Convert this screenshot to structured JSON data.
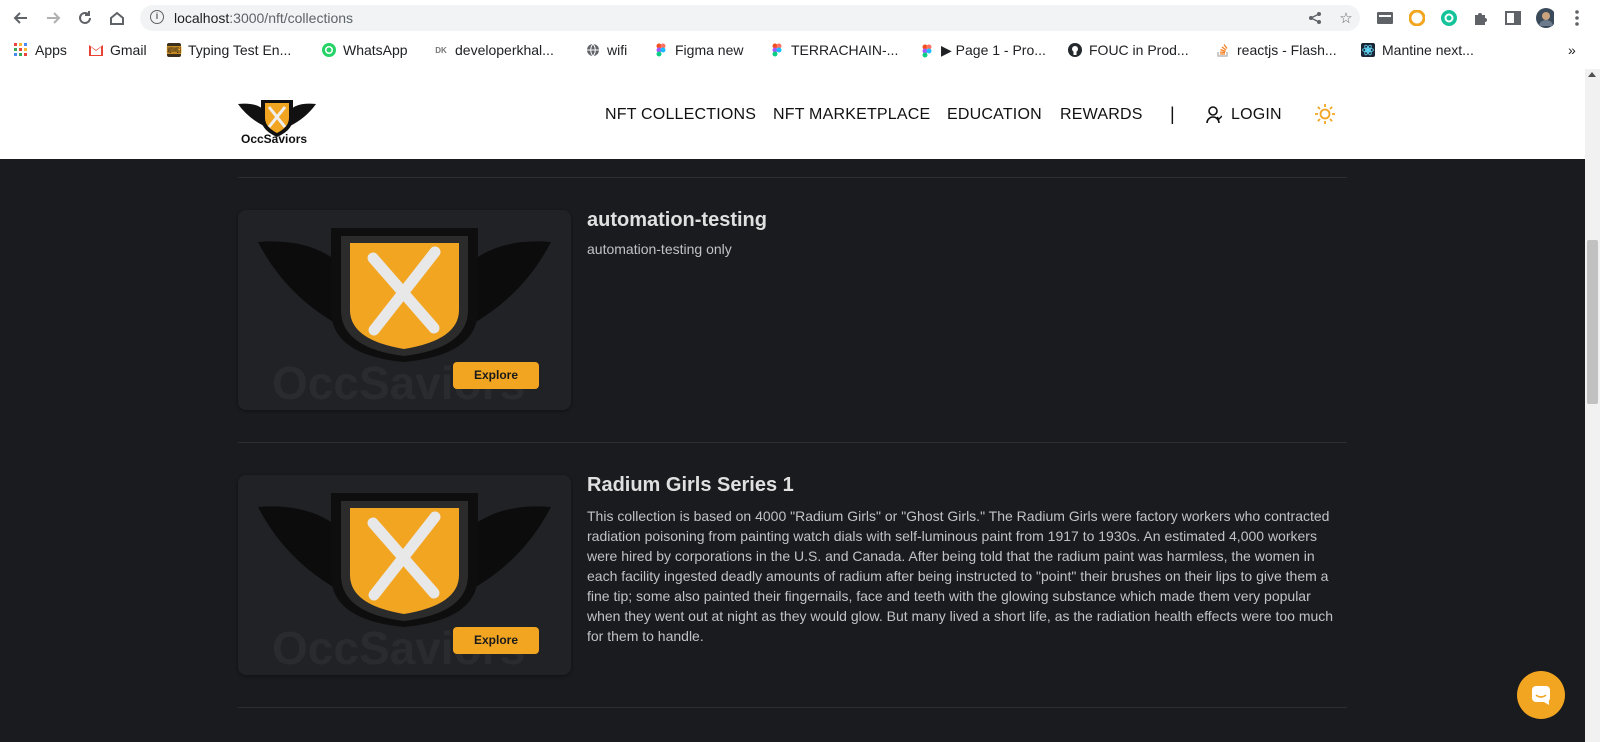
{
  "browser": {
    "url_host": "localhost",
    "url_path": ":3000/nft/collections",
    "bookmarks": [
      {
        "label": "Apps",
        "icon": "apps-grid-icon"
      },
      {
        "label": "Gmail",
        "icon": "gmail-icon"
      },
      {
        "label": "Typing Test En...",
        "icon": "typing-test-icon"
      },
      {
        "label": "WhatsApp",
        "icon": "whatsapp-icon"
      },
      {
        "label": "developerkhal...",
        "icon": "developer-icon"
      },
      {
        "label": "wifi",
        "icon": "globe-icon"
      },
      {
        "label": "Figma new",
        "icon": "figma-icon"
      },
      {
        "label": "TERRACHAIN-...",
        "icon": "figma-icon"
      },
      {
        "label": "▶ Page 1 - Pro...",
        "icon": "figma-icon"
      },
      {
        "label": "FOUC in Prod...",
        "icon": "github-icon"
      },
      {
        "label": "reactjs - Flash...",
        "icon": "stackoverflow-icon"
      },
      {
        "label": "Mantine next...",
        "icon": "mantine-icon"
      }
    ],
    "more_bookmarks": "»"
  },
  "header": {
    "logo_text": "OccSaviors",
    "nav": {
      "collections": "NFT COLLECTIONS",
      "marketplace": "NFT MARKETPLACE",
      "education": "EDUCATION",
      "rewards": "REWARDS",
      "separator": "|",
      "login": "LOGIN"
    }
  },
  "collections": [
    {
      "title": "automation-testing",
      "description": "automation-testing only",
      "button": "Explore",
      "watermark": "OccSaviors"
    },
    {
      "title": "Radium Girls Series 1",
      "description": "This collection is based on 4000 \"Radium Girls\" or \"Ghost Girls.\" The Radium Girls were factory workers who contracted radiation poisoning from painting watch dials with self-luminous paint from 1917 to 1930s. An estimated 4,000 workers were hired by corporations in the U.S. and Canada. After being told that the radium paint was harmless, the women in each facility ingested deadly amounts of radium after being instructed to \"point\" their brushes on their lips to give them a fine tip; some also painted their fingernails, face and teeth with the glowing substance which made them very popular when they went out at night as they would glow. But many lived a short life, as the radiation health effects were too much for them to handle.",
      "button": "Explore",
      "watermark": "OccSaviors"
    }
  ],
  "colors": {
    "accent": "#f2a521",
    "background": "#1a1b1e",
    "card": "#212226",
    "text": "#c1c2c5"
  }
}
